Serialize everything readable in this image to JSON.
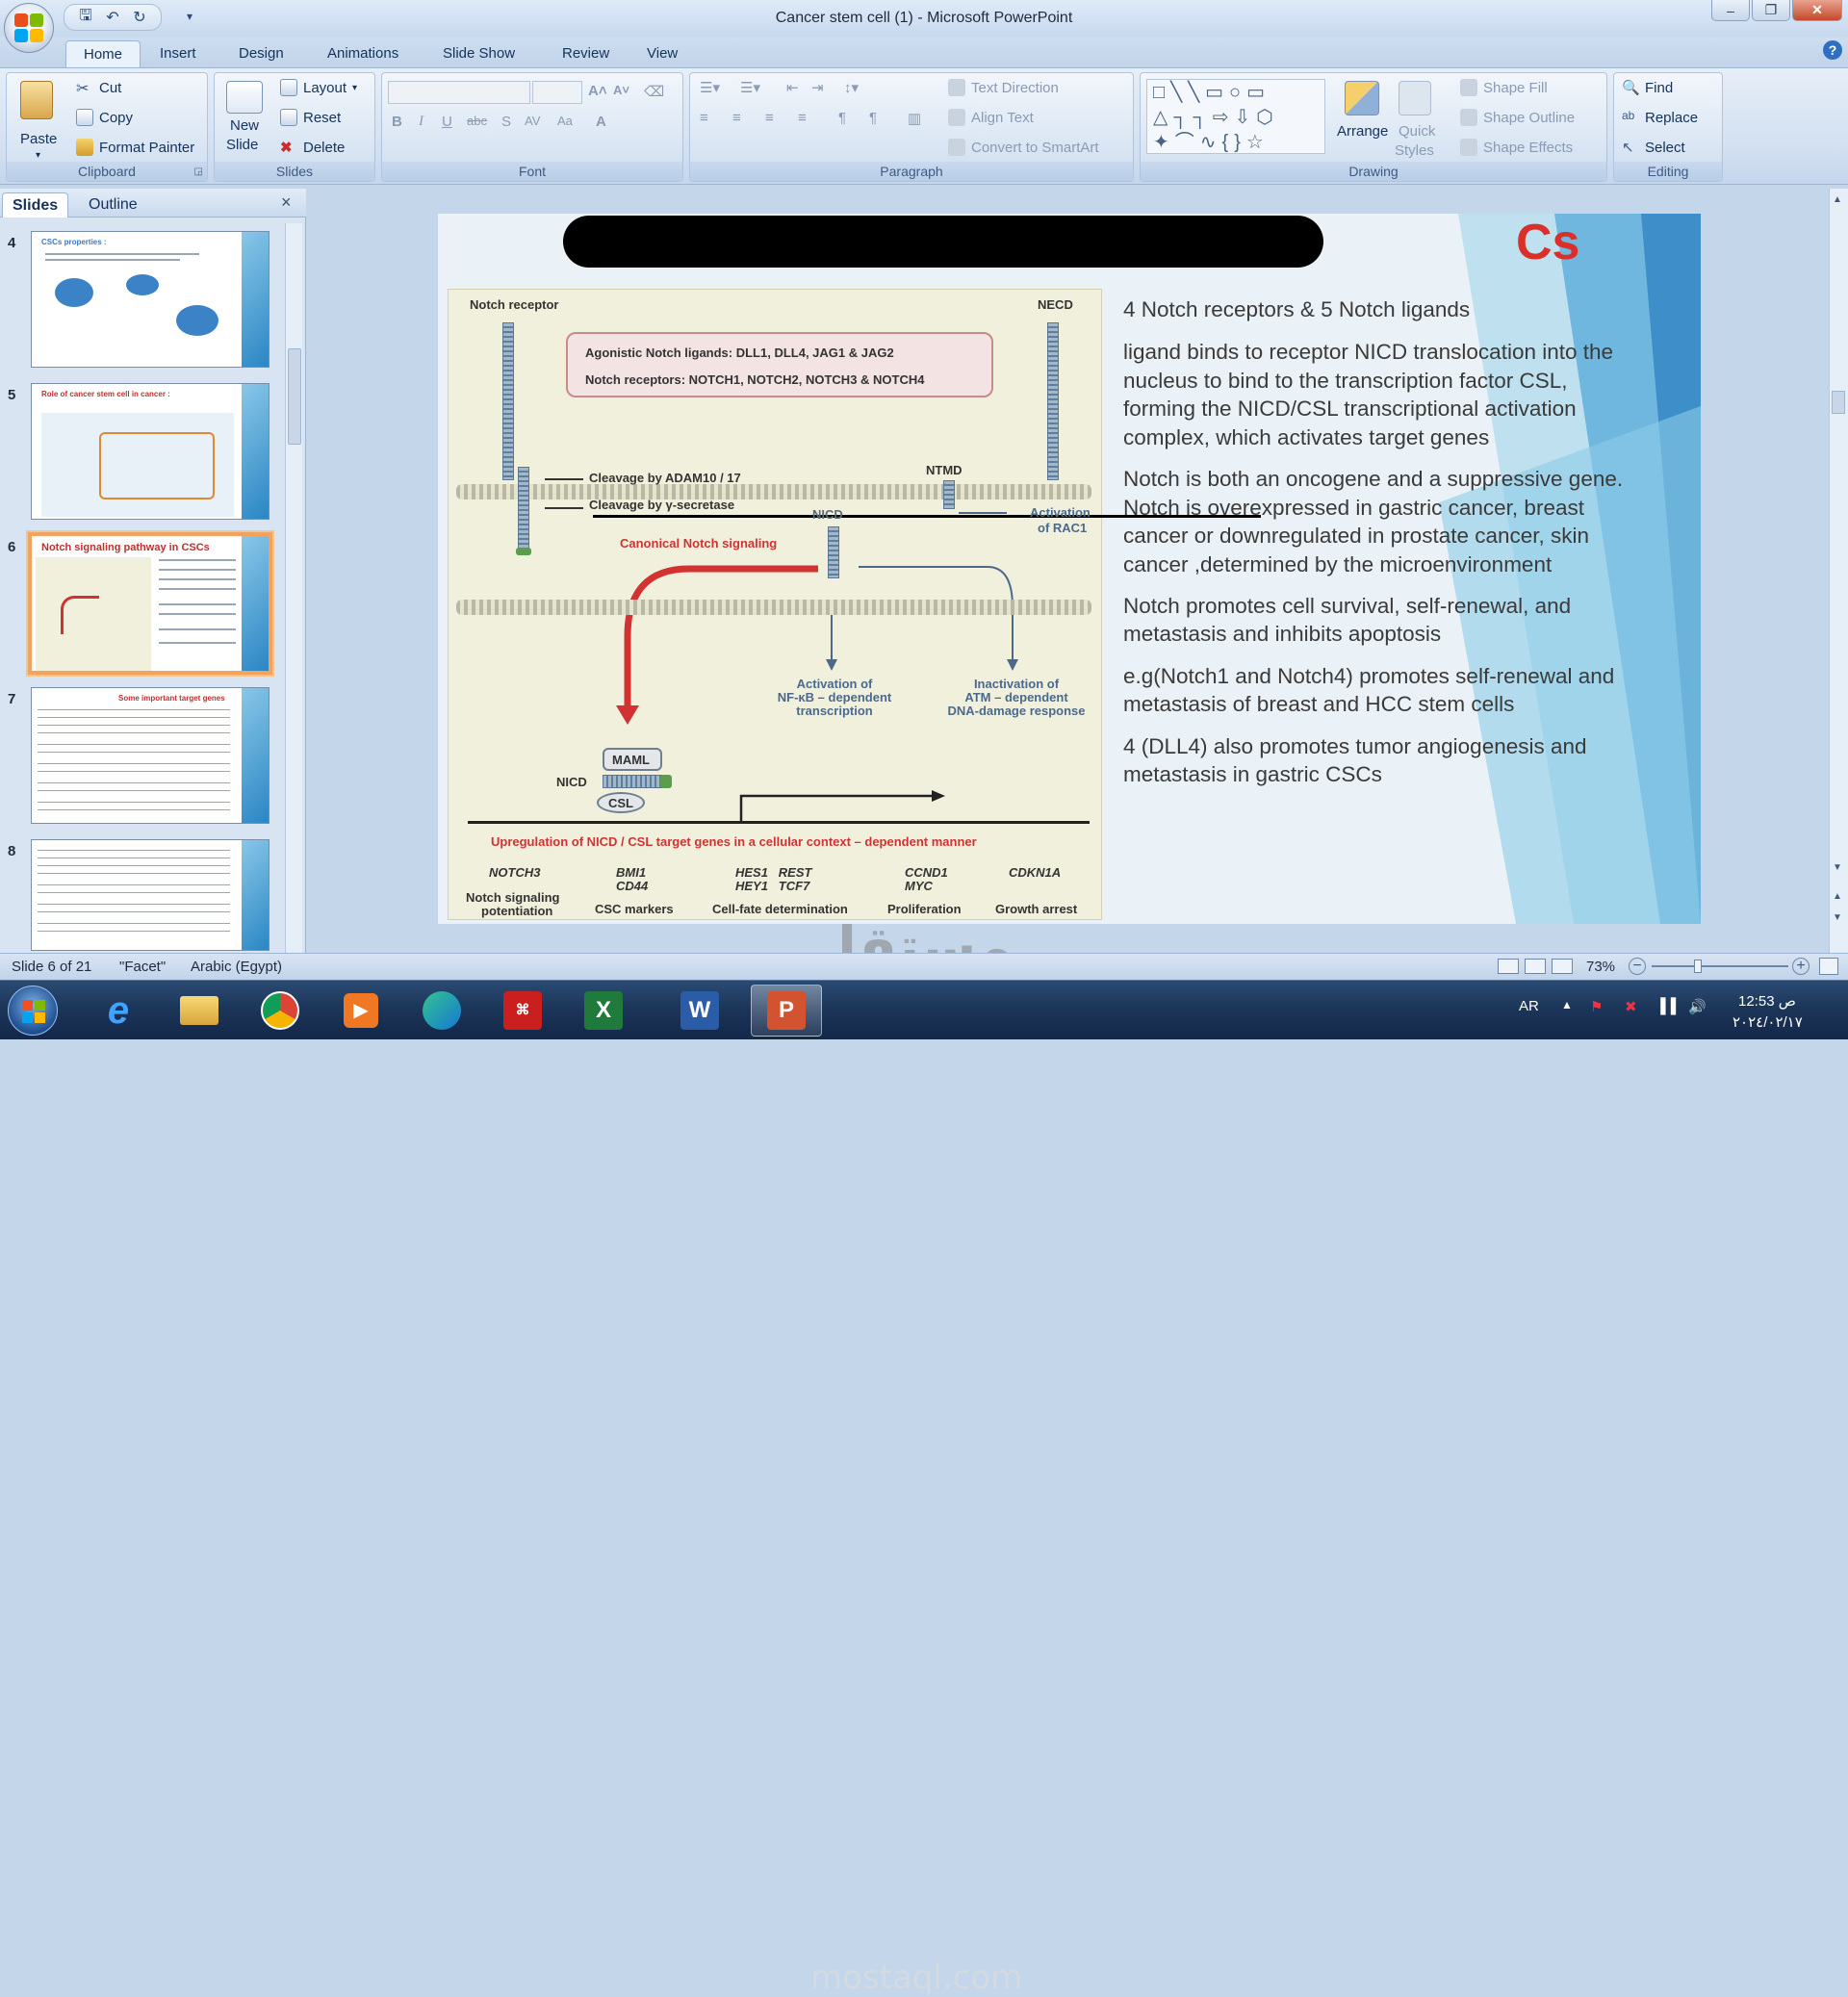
{
  "window": {
    "title": "Cancer stem cell (1) - Microsoft PowerPoint"
  },
  "ribbon_tabs": [
    "Home",
    "Insert",
    "Design",
    "Animations",
    "Slide Show",
    "Review",
    "View"
  ],
  "ribbon": {
    "clipboard": {
      "paste": "Paste",
      "cut": "Cut",
      "copy": "Copy",
      "format_painter": "Format Painter",
      "label": "Clipboard"
    },
    "slides": {
      "new_slide_1": "New",
      "new_slide_2": "Slide",
      "layout": "Layout",
      "reset": "Reset",
      "delete": "Delete",
      "label": "Slides"
    },
    "font": {
      "label": "Font"
    },
    "paragraph": {
      "text_direction": "Text Direction",
      "align_text": "Align Text",
      "convert": "Convert to SmartArt",
      "label": "Paragraph"
    },
    "drawing": {
      "arrange": "Arrange",
      "quick_styles_1": "Quick",
      "quick_styles_2": "Styles",
      "shape_fill": "Shape Fill",
      "shape_outline": "Shape Outline",
      "shape_effects": "Shape Effects",
      "label": "Drawing"
    },
    "editing": {
      "find": "Find",
      "replace": "Replace",
      "select": "Select",
      "label": "Editing"
    }
  },
  "pane": {
    "tab_slides": "Slides",
    "tab_outline": "Outline"
  },
  "thumbnails": [
    {
      "num": "4",
      "title": "CSCs properties :"
    },
    {
      "num": "5",
      "title": "Role of cancer stem cell in cancer :"
    },
    {
      "num": "6",
      "title": "Notch signaling pathway in CSCs"
    },
    {
      "num": "7",
      "title": "Some important target genes"
    },
    {
      "num": "8",
      "title": ""
    }
  ],
  "slide": {
    "title_tail": "Cs",
    "diagram": {
      "notch_receptor": "Notch receptor",
      "necd": "NECD",
      "ligands": "Agonistic Notch ligands: DLL1, DLL4, JAG1 & JAG2",
      "receptors": "Notch receptors: NOTCH1, NOTCH2, NOTCH3 & NOTCH4",
      "ntmd": "NTMD",
      "cleavage_adam": "Cleavage by ADAM10 / 17",
      "cleavage_gamma": "Cleavage by γ-secretase",
      "nicd_top": "NICD",
      "activation_rac1_1": "Activation",
      "activation_rac1_2": "of RAC1",
      "canonical": "Canonical Notch signaling",
      "nfkb_1": "Activation of",
      "nfkb_2": "NF-κB – dependent",
      "nfkb_3": "transcription",
      "atm_1": "Inactivation of",
      "atm_2": "ATM – dependent",
      "atm_3": "DNA-damage response",
      "maml": "MAML",
      "nicd": "NICD",
      "csl": "CSL",
      "upregulation": "Upregulation of NICD / CSL target genes in a cellular context – dependent manner",
      "genes": [
        {
          "a": "NOTCH3",
          "b": "",
          "label_1": "Notch signaling",
          "label_2": "potentiation"
        },
        {
          "a": "BMI1",
          "b": "CD44",
          "label_1": "CSC markers",
          "label_2": ""
        },
        {
          "a": "HES1   REST",
          "b": "HEY1   TCF7",
          "label_1": "Cell-fate determination",
          "label_2": ""
        },
        {
          "a": "CCND1",
          "b": "MYC",
          "label_1": "Proliferation",
          "label_2": ""
        },
        {
          "a": "CDKN1A",
          "b": "",
          "label_1": "Growth arrest",
          "label_2": ""
        }
      ]
    },
    "bullets": [
      [
        "4 Notch receptors & 5 Notch ligands"
      ],
      [
        "ligand binds to receptor NICD translocation into the",
        "nucleus to bind to the transcription factor CSL,",
        "forming the NICD/CSL transcriptional activation",
        "complex, which activates target genes"
      ],
      [
        "Notch is both an oncogene and a suppressive gene.",
        "Notch is overexpressed in gastric cancer, breast",
        "cancer or downregulated in prostate cancer, skin",
        "cancer ,determined by the microenvironment"
      ],
      [
        " Notch promotes cell survival, self-renewal, and",
        "metastasis and inhibits apoptosis"
      ],
      [
        "e.g(Notch1 and Notch4) promotes self-renewal and",
        "metastasis of breast and HCC stem cells"
      ],
      [
        "4 (DLL4) also promotes tumor angiogenesis and",
        "metastasis in gastric CSCs"
      ]
    ]
  },
  "status": {
    "slide": "Slide 6 of 21",
    "theme": "\"Facet\"",
    "language": "Arabic (Egypt)",
    "zoom": "73%"
  },
  "watermark": {
    "text": "مستقل",
    "url": "mostaql.com"
  },
  "taskbar": {
    "lang": "AR",
    "time": "12:53 ص",
    "date": "٢٠٢٤/٠٢/١٧"
  },
  "colors": {
    "accent": "#f5a25d",
    "title_red": "#d9302a",
    "ribbon_blue": "#d2e0f1"
  }
}
